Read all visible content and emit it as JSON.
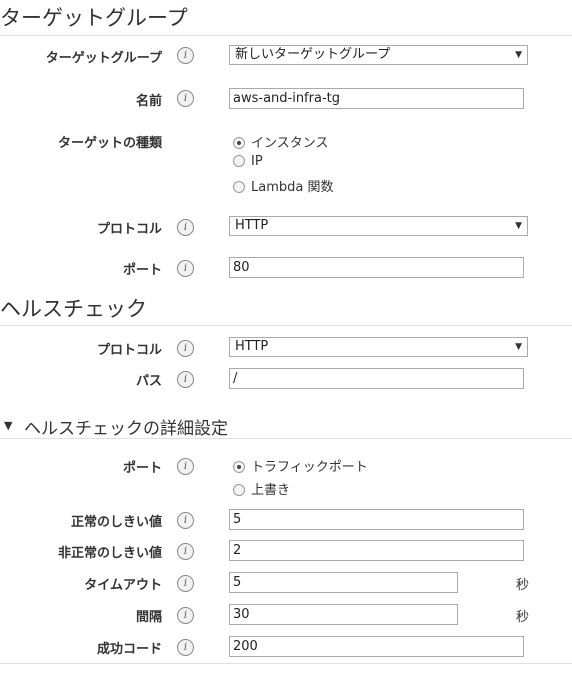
{
  "target_group_section": {
    "title": "ターゲットグループ",
    "target_group_label": "ターゲットグループ",
    "target_group_value": "新しいターゲットグループ",
    "name_label": "名前",
    "name_value": "aws-and-infra-tg",
    "target_type_label": "ターゲットの種類",
    "target_type_options": [
      "インスタンス",
      "IP",
      "Lambda 関数"
    ],
    "target_type_selected": "インスタンス",
    "protocol_label": "プロトコル",
    "protocol_value": "HTTP",
    "port_label": "ポート",
    "port_value": "80"
  },
  "health_check_section": {
    "title": "ヘルスチェック",
    "protocol_label": "プロトコル",
    "protocol_value": "HTTP",
    "path_label": "パス",
    "path_value": "/"
  },
  "advanced_section": {
    "title": "ヘルスチェックの詳細設定",
    "expanded": true,
    "port_label": "ポート",
    "port_options": [
      "トラフィックポート",
      "上書き"
    ],
    "port_selected": "トラフィックポート",
    "healthy_threshold_label": "正常のしきい値",
    "healthy_threshold_value": "5",
    "unhealthy_threshold_label": "非正常のしきい値",
    "unhealthy_threshold_value": "2",
    "timeout_label": "タイムアウト",
    "timeout_value": "5",
    "timeout_unit": "秒",
    "interval_label": "間隔",
    "interval_value": "30",
    "interval_unit": "秒",
    "success_codes_label": "成功コード",
    "success_codes_value": "200"
  },
  "icons": {
    "info": "i",
    "dropdown": "▼",
    "collapse": "▼"
  }
}
